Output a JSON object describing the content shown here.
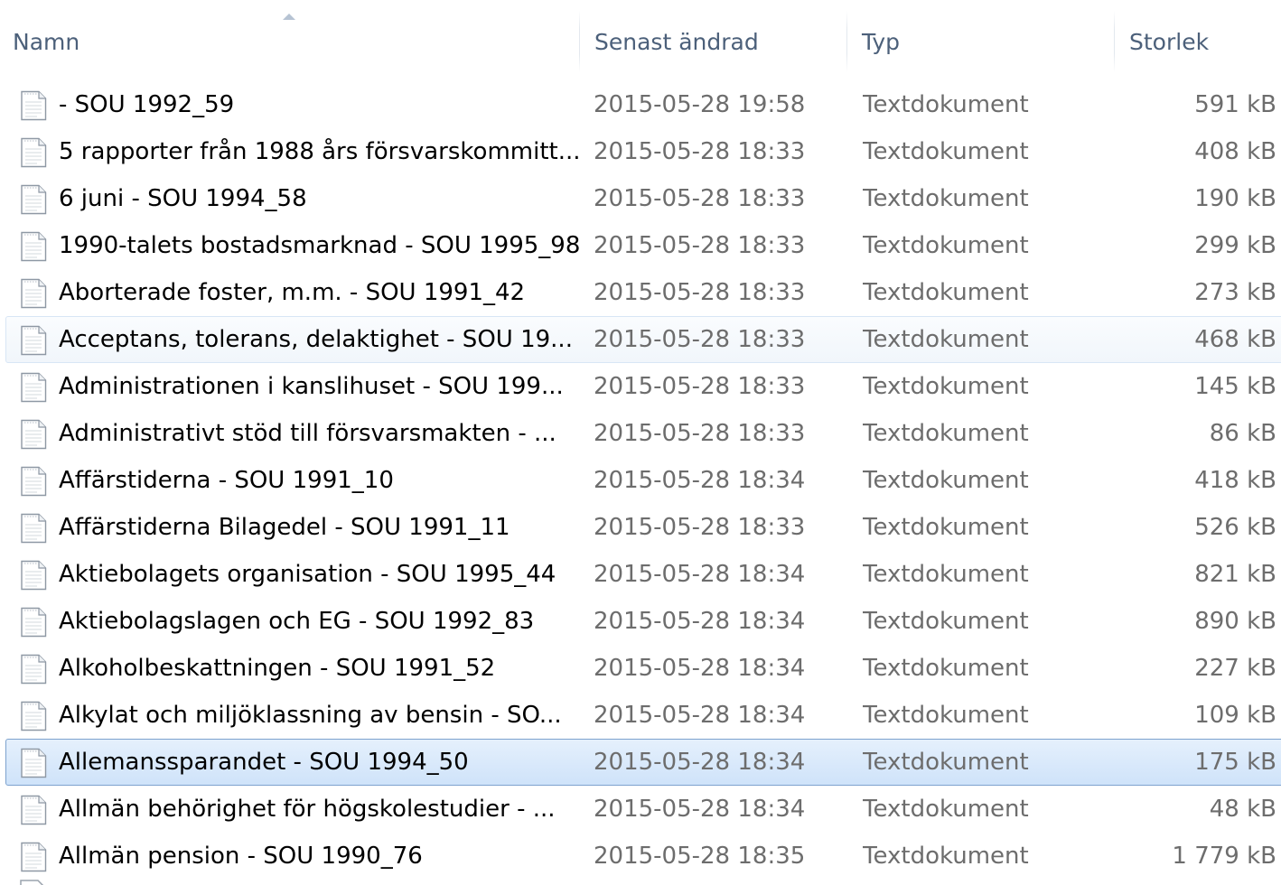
{
  "columns": {
    "name": "Namn",
    "modified": "Senast ändrad",
    "type": "Typ",
    "size": "Storlek"
  },
  "sort": {
    "column": "name",
    "direction": "ascending"
  },
  "icon": "text-document-icon",
  "colors": {
    "header_text": "#4c607a",
    "name_text": "#000000",
    "detail_text": "#6d6d6d",
    "selected_border": "#7da2ce",
    "selected_fill": "#cfe3fa",
    "hover_border": "#d8e6f5"
  },
  "files": [
    {
      "name": "- SOU 1992_59",
      "modified": "2015-05-28 19:58",
      "type": "Textdokument",
      "size": "591 kB",
      "state": "normal"
    },
    {
      "name": "5 rapporter från 1988 års försvarskommitt...",
      "modified": "2015-05-28 18:33",
      "type": "Textdokument",
      "size": "408 kB",
      "state": "normal"
    },
    {
      "name": "6 juni - SOU 1994_58",
      "modified": "2015-05-28 18:33",
      "type": "Textdokument",
      "size": "190 kB",
      "state": "normal"
    },
    {
      "name": "1990-talets bostadsmarknad - SOU 1995_98",
      "modified": "2015-05-28 18:33",
      "type": "Textdokument",
      "size": "299 kB",
      "state": "normal"
    },
    {
      "name": "Aborterade foster, m.m. - SOU 1991_42",
      "modified": "2015-05-28 18:33",
      "type": "Textdokument",
      "size": "273 kB",
      "state": "normal"
    },
    {
      "name": "Acceptans, tolerans, delaktighet - SOU 19...",
      "modified": "2015-05-28 18:33",
      "type": "Textdokument",
      "size": "468 kB",
      "state": "hover"
    },
    {
      "name": "Administrationen i kanslihuset - SOU 199...",
      "modified": "2015-05-28 18:33",
      "type": "Textdokument",
      "size": "145 kB",
      "state": "normal"
    },
    {
      "name": "Administrativt stöd till försvarsmakten - ...",
      "modified": "2015-05-28 18:33",
      "type": "Textdokument",
      "size": "86 kB",
      "state": "normal"
    },
    {
      "name": "Affärstiderna - SOU 1991_10",
      "modified": "2015-05-28 18:34",
      "type": "Textdokument",
      "size": "418 kB",
      "state": "normal"
    },
    {
      "name": "Affärstiderna Bilagedel - SOU 1991_11",
      "modified": "2015-05-28 18:33",
      "type": "Textdokument",
      "size": "526 kB",
      "state": "normal"
    },
    {
      "name": "Aktiebolagets organisation - SOU 1995_44",
      "modified": "2015-05-28 18:34",
      "type": "Textdokument",
      "size": "821 kB",
      "state": "normal"
    },
    {
      "name": "Aktiebolagslagen och EG - SOU 1992_83",
      "modified": "2015-05-28 18:34",
      "type": "Textdokument",
      "size": "890 kB",
      "state": "normal"
    },
    {
      "name": "Alkoholbeskattningen - SOU 1991_52",
      "modified": "2015-05-28 18:34",
      "type": "Textdokument",
      "size": "227 kB",
      "state": "normal"
    },
    {
      "name": "Alkylat och miljöklassning av bensin - SO...",
      "modified": "2015-05-28 18:34",
      "type": "Textdokument",
      "size": "109 kB",
      "state": "normal"
    },
    {
      "name": "Allemanssparandet - SOU 1994_50",
      "modified": "2015-05-28 18:34",
      "type": "Textdokument",
      "size": "175 kB",
      "state": "selected"
    },
    {
      "name": "Allmän behörighet för högskolestudier - ...",
      "modified": "2015-05-28 18:34",
      "type": "Textdokument",
      "size": "48 kB",
      "state": "normal"
    },
    {
      "name": "Allmän pension - SOU 1990_76",
      "modified": "2015-05-28 18:35",
      "type": "Textdokument",
      "size": "1 779 kB",
      "state": "normal"
    }
  ]
}
